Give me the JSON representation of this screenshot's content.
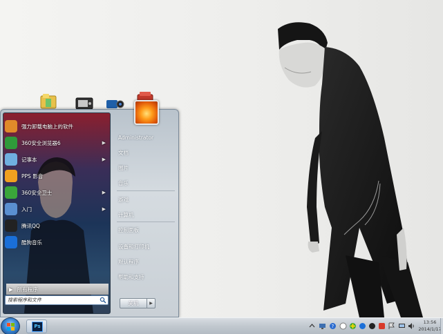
{
  "desktop": {
    "shortcuts": [
      "folder-icon",
      "media-player-icon",
      "camera-icon",
      "app-center-icon"
    ]
  },
  "start_menu": {
    "programs": [
      {
        "label": "强力卸载电脑上的软件",
        "icon": "uninstall-icon",
        "color": "#e08a2a",
        "submenu": false
      },
      {
        "label": "360安全浏览器6",
        "icon": "360-browser-icon",
        "color": "#2f9a3a",
        "submenu": true
      },
      {
        "label": "记事本",
        "icon": "notepad-icon",
        "color": "#6fb0e0",
        "submenu": true
      },
      {
        "label": "PPS 影音",
        "icon": "pps-icon",
        "color": "#f0a020",
        "submenu": false
      },
      {
        "label": "360安全卫士",
        "icon": "360-guard-icon",
        "color": "#3aa63a",
        "submenu": true
      },
      {
        "label": "入门",
        "icon": "getting-started-icon",
        "color": "#5a8fd0",
        "submenu": true
      },
      {
        "label": "腾讯QQ",
        "icon": "qq-icon",
        "color": "#222222",
        "submenu": false
      },
      {
        "label": "酷狗音乐",
        "icon": "kugou-icon",
        "color": "#1a6fd8",
        "submenu": false
      }
    ],
    "all_programs": "所有程序",
    "search_placeholder": "搜索程序和文件",
    "right_items": [
      {
        "label": "Administrator"
      },
      {
        "label": "文档"
      },
      {
        "label": "图片"
      },
      {
        "label": "音乐"
      },
      {
        "label": "游戏"
      },
      {
        "label": "计算机"
      },
      {
        "label": "控制面板"
      },
      {
        "label": "设备和打印机"
      },
      {
        "label": "默认程序"
      },
      {
        "label": "帮助和支持"
      }
    ],
    "shutdown_label": "关机",
    "shutdown_arrow": "▶"
  },
  "taskbar": {
    "ps_label": "Ps",
    "time": "13:56",
    "date": "2014/1/17"
  },
  "colors": {
    "taskbar": "#c1c8cf",
    "start_menu": "#d5dbe0",
    "accent_orange": "#ff9c1a"
  }
}
